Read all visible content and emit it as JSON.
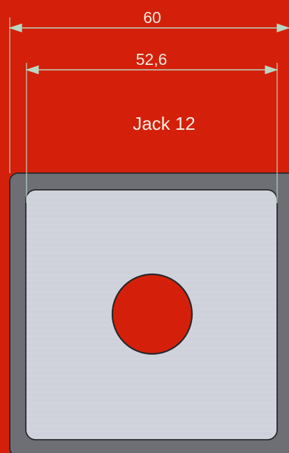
{
  "dimensions": {
    "outer_width_label": "60",
    "inner_width_label": "52,6"
  },
  "component_label": "Jack 12",
  "colors": {
    "background": "#d4200a",
    "frame": "#6d6f75",
    "panel": "#cfd2da",
    "outline": "#25272b",
    "dimension_line": "#b9d7c3",
    "hole": "#d4200a"
  }
}
